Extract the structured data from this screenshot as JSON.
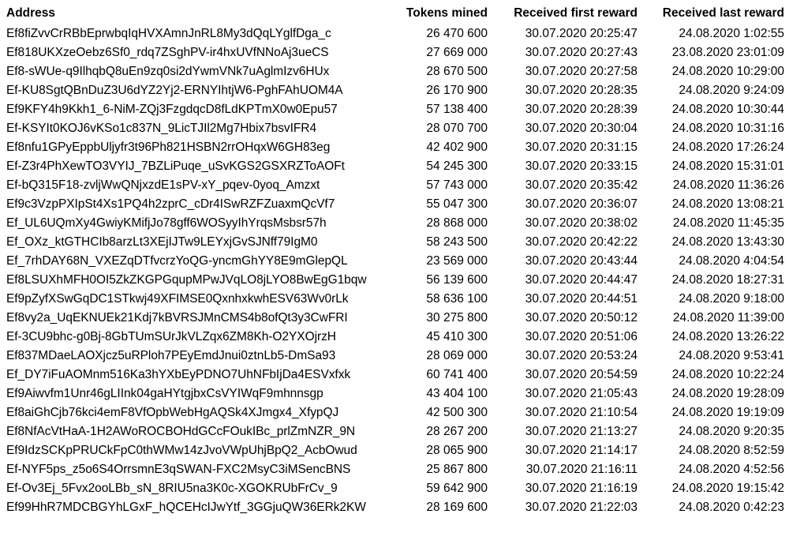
{
  "table": {
    "columns": [
      {
        "key": "address",
        "label": "Address",
        "align": "left"
      },
      {
        "key": "tokens_mined",
        "label": "Tokens mined",
        "align": "right"
      },
      {
        "key": "received_first_reward",
        "label": "Received first reward",
        "align": "right"
      },
      {
        "key": "received_last_reward",
        "label": "Received last reward",
        "align": "right"
      }
    ],
    "rows": [
      {
        "address": "Ef8fiZvvCrRBbEprwbqIqHVXAmnJnRL8My3dQqLYglfDga_c",
        "tokens_mined": "26 470 600",
        "received_first_reward": "30.07.2020 20:25:47",
        "received_last_reward": "24.08.2020 1:02:55"
      },
      {
        "address": "Ef818UKXzeOebz6Sf0_rdq7ZSghPV-ir4hxUVfNNoAj3ueCS",
        "tokens_mined": "27 669 000",
        "received_first_reward": "30.07.2020 20:27:43",
        "received_last_reward": "23.08.2020 23:01:09"
      },
      {
        "address": "Ef8-sWUe-q9IlhqbQ8uEn9zq0si2dYwmVNk7uAglmIzv6HUx",
        "tokens_mined": "28 670 500",
        "received_first_reward": "30.07.2020 20:27:58",
        "received_last_reward": "24.08.2020 10:29:00"
      },
      {
        "address": "Ef-KU8SgtQBnDuZ3U6dYZ2Yj2-ERNYIhtjW6-PghFAhUOM4A",
        "tokens_mined": "26 170 900",
        "received_first_reward": "30.07.2020 20:28:35",
        "received_last_reward": "24.08.2020 9:24:09"
      },
      {
        "address": "Ef9KFY4h9Kkh1_6-NiM-ZQj3FzgdqcD8fLdKPTmX0w0Epu57",
        "tokens_mined": "57 138 400",
        "received_first_reward": "30.07.2020 20:28:39",
        "received_last_reward": "24.08.2020 10:30:44"
      },
      {
        "address": "Ef-KSYIt0KOJ6vKSo1c837N_9LicTJIl2Mg7Hbix7bsvIFR4",
        "tokens_mined": "28 070 700",
        "received_first_reward": "30.07.2020 20:30:04",
        "received_last_reward": "24.08.2020 10:31:16"
      },
      {
        "address": "Ef8nfu1GPyEppbUljyfr3t96Ph821HSBN2rrOHqxW6GH83eg",
        "tokens_mined": "42 402 900",
        "received_first_reward": "30.07.2020 20:31:15",
        "received_last_reward": "24.08.2020 17:26:24"
      },
      {
        "address": "Ef-Z3r4PhXewTO3VYIJ_7BZLiPuqe_uSvKGS2GSXRZToAOFt",
        "tokens_mined": "54 245 300",
        "received_first_reward": "30.07.2020 20:33:15",
        "received_last_reward": "24.08.2020 15:31:01"
      },
      {
        "address": "Ef-bQ315F18-zvljWwQNjxzdE1sPV-xY_pqev-0yoq_Amzxt",
        "tokens_mined": "57 743 000",
        "received_first_reward": "30.07.2020 20:35:42",
        "received_last_reward": "24.08.2020 11:36:26"
      },
      {
        "address": "Ef9c3VzpPXIpSt4Xs1PQ4h2zprC_cDr4ISwRZFZuaxmQcVf7",
        "tokens_mined": "55 047 300",
        "received_first_reward": "30.07.2020 20:36:07",
        "received_last_reward": "24.08.2020 13:08:21"
      },
      {
        "address": "Ef_UL6UQmXy4GwiyKMifjJo78gff6WOSyyIhYrqsMsbsr57h",
        "tokens_mined": "28 868 000",
        "received_first_reward": "30.07.2020 20:38:02",
        "received_last_reward": "24.08.2020 11:45:35"
      },
      {
        "address": "Ef_OXz_ktGTHCIb8arzLt3XEjIJTw9LEYxjGvSJNff79IgM0",
        "tokens_mined": "58 243 500",
        "received_first_reward": "30.07.2020 20:42:22",
        "received_last_reward": "24.08.2020 13:43:30"
      },
      {
        "address": "Ef_7rhDAY68N_VXEZqDTfvcrzYoQG-yncmGhYY8E9mGlepQL",
        "tokens_mined": "23 569 000",
        "received_first_reward": "30.07.2020 20:43:44",
        "received_last_reward": "24.08.2020 4:04:54"
      },
      {
        "address": "Ef8LSUXhMFH0OI5ZkZKGPGqupMPwJVqLO8jLYO8BwEgG1bqw",
        "tokens_mined": "56 139 600",
        "received_first_reward": "30.07.2020 20:44:47",
        "received_last_reward": "24.08.2020 18:27:31"
      },
      {
        "address": "Ef9pZyfXSwGqDC1STkwj49XFIMSE0QxnhxkwhESV63Wv0rLk",
        "tokens_mined": "58 636 100",
        "received_first_reward": "30.07.2020 20:44:51",
        "received_last_reward": "24.08.2020 9:18:00"
      },
      {
        "address": "Ef8vy2a_UqEKNUEk21Kdj7kBVRSJMnCMS4b8ofQt3y3CwFRI",
        "tokens_mined": "30 275 800",
        "received_first_reward": "30.07.2020 20:50:12",
        "received_last_reward": "24.08.2020 11:39:00"
      },
      {
        "address": "Ef-3CU9bhc-g0Bj-8GbTUmSUrJkVLZqx6ZM8Kh-O2YXOjrzH",
        "tokens_mined": "45 410 300",
        "received_first_reward": "30.07.2020 20:51:06",
        "received_last_reward": "24.08.2020 13:26:22"
      },
      {
        "address": "Ef837MDaeLAOXjcz5uRPloh7PEyEmdJnui0ztnLb5-DmSa93",
        "tokens_mined": "28 069 000",
        "received_first_reward": "30.07.2020 20:53:24",
        "received_last_reward": "24.08.2020 9:53:41"
      },
      {
        "address": "Ef_DY7iFuAOMnm516Ka3hYXbEyPDNO7UhNFbIjDa4ESVxfxk",
        "tokens_mined": "60 741 400",
        "received_first_reward": "30.07.2020 20:54:59",
        "received_last_reward": "24.08.2020 10:22:24"
      },
      {
        "address": "Ef9Aiwvfm1Unr46gLIInk04gaHYtgjbxCsVYIWqF9mhnnsgp",
        "tokens_mined": "43 404 100",
        "received_first_reward": "30.07.2020 21:05:43",
        "received_last_reward": "24.08.2020 19:28:09"
      },
      {
        "address": "Ef8aiGhCjb76kci4emF8VfOpbWebHgAQSk4XJmgx4_XfypQJ",
        "tokens_mined": "42 500 300",
        "received_first_reward": "30.07.2020 21:10:54",
        "received_last_reward": "24.08.2020 19:19:09"
      },
      {
        "address": "Ef8NfAcVtHaA-1H2AWoROCBOHdGCcFOukIBc_prlZmNZR_9N",
        "tokens_mined": "28 267 200",
        "received_first_reward": "30.07.2020 21:13:27",
        "received_last_reward": "24.08.2020 9:20:35"
      },
      {
        "address": "Ef9IdzSCKpPRUCkFpC0thWMw14zJvoVWpUhjBpQ2_AcbOwud",
        "tokens_mined": "28 065 900",
        "received_first_reward": "30.07.2020 21:14:17",
        "received_last_reward": "24.08.2020 8:52:59"
      },
      {
        "address": "Ef-NYF5ps_z5o6S4OrrsmnE3qSWAN-FXC2MsyC3iMSencBNS",
        "tokens_mined": "25 867 800",
        "received_first_reward": "30.07.2020 21:16:11",
        "received_last_reward": "24.08.2020 4:52:56"
      },
      {
        "address": "Ef-Ov3Ej_5Fvx2ooLBb_sN_8RIU5na3K0c-XGOKRUbFrCv_9",
        "tokens_mined": "59 642 900",
        "received_first_reward": "30.07.2020 21:16:19",
        "received_last_reward": "24.08.2020 19:15:42"
      },
      {
        "address": "Ef99HhR7MDCBGYhLGxF_hQCEHcIJwYtf_3GGjuQW36ERk2KW",
        "tokens_mined": "28 169 600",
        "received_first_reward": "30.07.2020 21:22:03",
        "received_last_reward": "24.08.2020 0:42:23"
      }
    ]
  }
}
